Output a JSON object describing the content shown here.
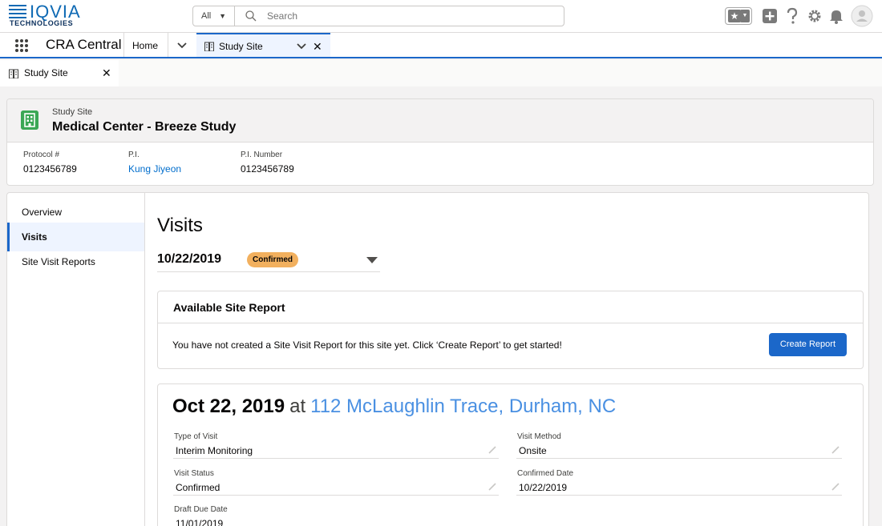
{
  "header": {
    "logo_word": "IQVIA",
    "logo_sub": "TECHNOLOGIES",
    "search_scope": "All",
    "search_placeholder": "Search"
  },
  "appnav": {
    "app_name": "CRA Central",
    "home_label": "Home",
    "tab_label": "Study Site"
  },
  "subtab": {
    "label": "Study Site"
  },
  "record": {
    "type_label": "Study Site",
    "title": "Medical Center - Breeze Study",
    "fields": [
      {
        "label": "Protocol #",
        "value": "0123456789"
      },
      {
        "label": "P.I.",
        "value": "Kung Jiyeon"
      },
      {
        "label": "P.I. Number",
        "value": "0123456789"
      }
    ]
  },
  "sidebar": {
    "items": [
      {
        "label": "Overview"
      },
      {
        "label": "Visits"
      },
      {
        "label": "Site Visit Reports"
      }
    ]
  },
  "visits": {
    "title": "Visits",
    "selected_date": "10/22/2019",
    "status_badge": "Confirmed"
  },
  "available": {
    "heading": "Available Site Report",
    "message": "You have not created a Site Visit Report for this site yet. Click ‘Create Report’ to get started!",
    "button_label": "Create Report"
  },
  "visit_detail": {
    "date": "Oct 22, 2019",
    "at": "at",
    "location": "112 McLaughlin Trace, Durham, NC",
    "fields": [
      {
        "label": "Type of Visit",
        "value": "Interim Monitoring"
      },
      {
        "label": "Visit Method",
        "value": "Onsite"
      },
      {
        "label": "Visit Status",
        "value": "Confirmed"
      },
      {
        "label": "Confirmed Date",
        "value": "10/22/2019"
      },
      {
        "label": "Draft Due Date",
        "value": "11/01/2019"
      }
    ]
  },
  "colors": {
    "brand": "#0f6ab4",
    "accent": "#1b67c9",
    "record_icon": "#3ba755",
    "badge": "#f2b05e",
    "link": "#006dcc",
    "location": "#4a90e2"
  }
}
